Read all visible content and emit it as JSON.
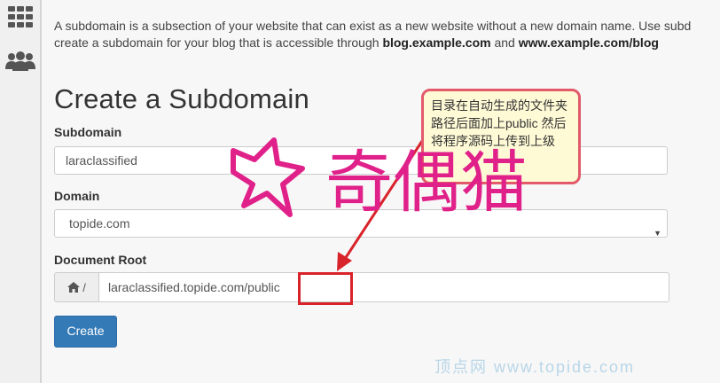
{
  "sidebar": {
    "items": [
      {
        "icon": "grid-icon"
      },
      {
        "icon": "users-icon"
      }
    ]
  },
  "intro": {
    "line1": "A subdomain is a subsection of your website that can exist as a new website without a new domain name. Use subd",
    "line2_prefix": "create a subdomain for your blog that is accessible through ",
    "line2_bold1": "blog.example.com",
    "line2_mid": " and ",
    "line2_bold2": "www.example.com/blog"
  },
  "page_title": "Create a Subdomain",
  "form": {
    "subdomain_label": "Subdomain",
    "subdomain_value": "laraclassified",
    "domain_label": "Domain",
    "domain_value": "topide.com",
    "docroot_label": "Document Root",
    "docroot_prefix": "/",
    "docroot_value": "laraclassified.topide.com/public",
    "create_button": "Create"
  },
  "annotation": {
    "text": "目录在自动生成的文件夹路径后面加上public 然后将程序源码上传到上级"
  },
  "watermark": {
    "brand": "奇偶猫",
    "footer": "顶点网 www.topide.com"
  },
  "colors": {
    "primary": "#337ab7",
    "annotation_border": "#d9232b",
    "callout_bg": "#fffad6",
    "watermark": "#e0218a"
  }
}
